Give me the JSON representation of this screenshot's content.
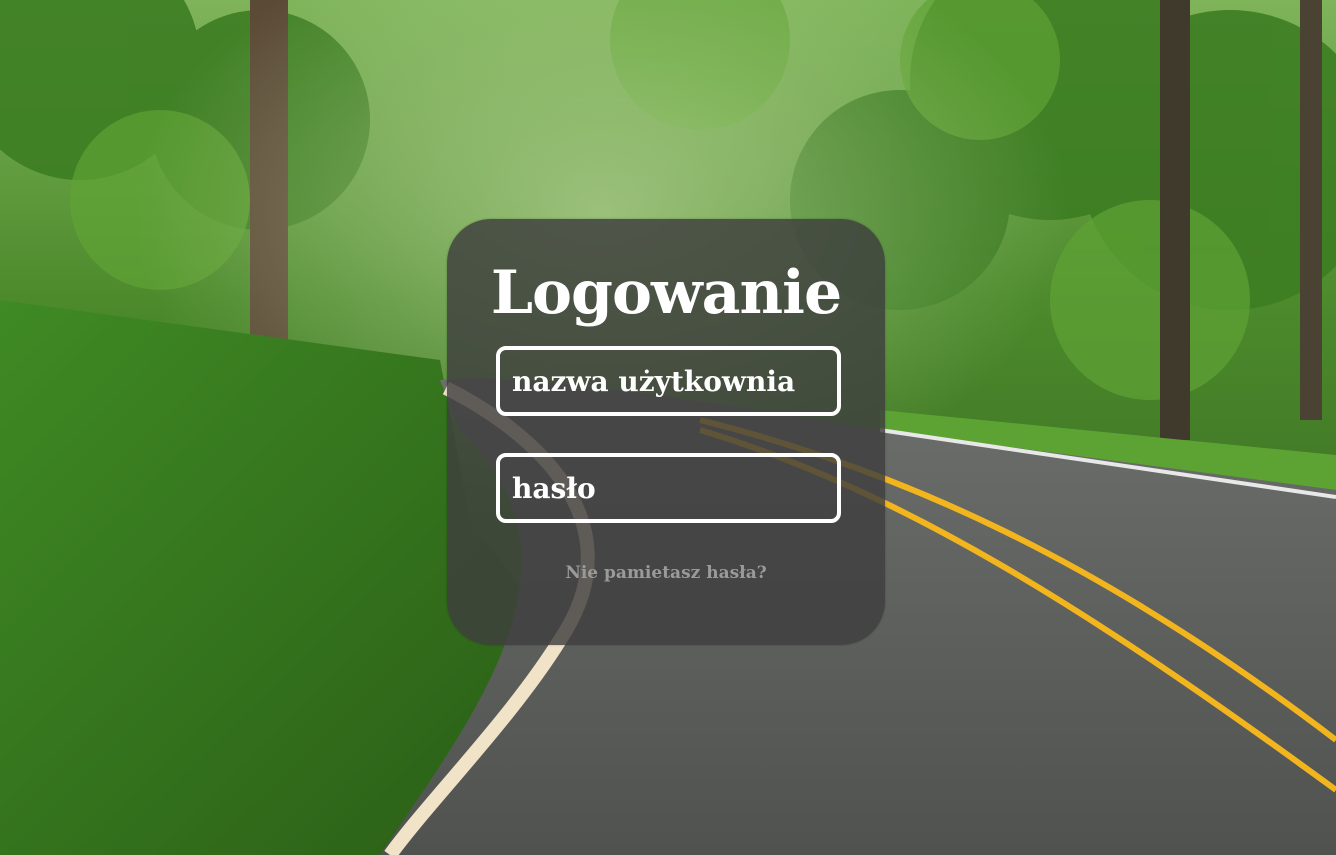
{
  "login": {
    "title": "Logowanie",
    "username_placeholder": "nazwa użytkownia",
    "password_placeholder": "hasło",
    "forgot_link": "Nie pamietasz hasła?"
  },
  "colors": {
    "card_bg": "#3e3e3e",
    "field_border": "#ffffff",
    "title_text": "#ffffff",
    "link_text": "#9a9a9a",
    "road_line_yellow": "#f2b51d"
  },
  "background": {
    "subject": "forest-road-image"
  }
}
